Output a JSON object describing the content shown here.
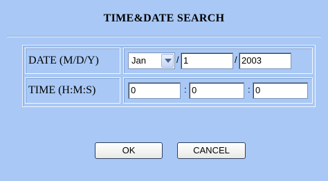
{
  "title": "TIME&DATE SEARCH",
  "date": {
    "label": "DATE (M/D/Y)",
    "month": "Jan",
    "sep1": "/",
    "day": "1",
    "sep2": "/",
    "year": "2003"
  },
  "time": {
    "label": "TIME (H:M:S)",
    "hour": "0",
    "sep1": ":",
    "minute": "0",
    "sep2": ":",
    "second": "0"
  },
  "buttons": {
    "ok": "OK",
    "cancel": "CANCEL"
  },
  "colors": {
    "background": "#a9c8f5"
  }
}
